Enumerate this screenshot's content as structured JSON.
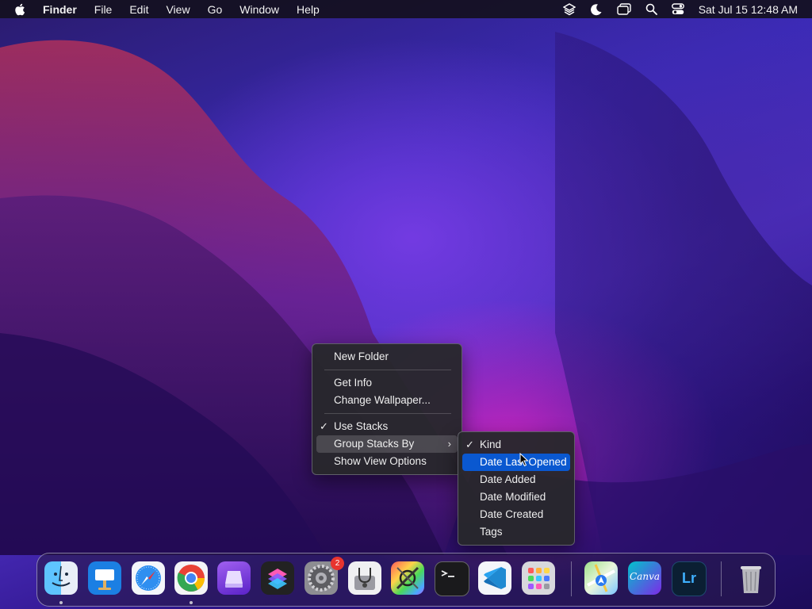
{
  "menubar": {
    "app_name": "Finder",
    "items": [
      "File",
      "Edit",
      "View",
      "Go",
      "Window",
      "Help"
    ],
    "clock": "Sat Jul 15  12:48 AM"
  },
  "context_menu": {
    "new_folder": "New Folder",
    "get_info": "Get Info",
    "change_wallpaper": "Change Wallpaper...",
    "use_stacks": "Use Stacks",
    "group_stacks_by": "Group Stacks By",
    "show_view_options": "Show View Options"
  },
  "submenu": {
    "items": [
      "Kind",
      "Date Last Opened",
      "Date Added",
      "Date Modified",
      "Date Created",
      "Tags"
    ],
    "checked": "Kind",
    "highlighted": "Date Last Opened"
  },
  "dock": {
    "system_settings_badge": "2",
    "canva_label": "Canva",
    "lightroom_label": "Lr"
  },
  "colors": {
    "menu_highlight": "#0a58d0",
    "badge": "#e8352f"
  }
}
